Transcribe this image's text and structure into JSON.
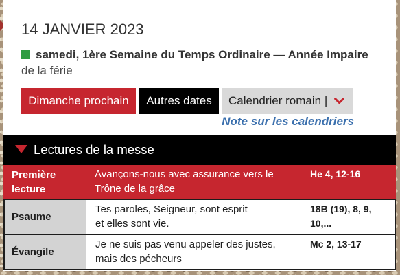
{
  "day": {
    "date": "14 JANVIER 2023",
    "title": "samedi, 1ère Semaine du Temps Ordinaire — Année Impaire",
    "celebration": "de la férie",
    "liturgical_color": "#2e9c42"
  },
  "actions": {
    "next_sunday": "Dimanche prochain",
    "other_dates": "Autres dates",
    "calendar": "Calendrier romain |",
    "calendar_icon": "chevron-down-icon",
    "calendar_note": "Note sur les calendriers"
  },
  "readings": {
    "heading": "Lectures de la messe",
    "heading_icon": "triangle-down-icon",
    "items": [
      {
        "label": "Première lecture",
        "text_lines": [
          "Avançons-nous avec assurance vers le",
          "Trône de la grâce"
        ],
        "reference": "He 4, 12-16",
        "selected": true
      },
      {
        "label": "Psaume",
        "text_lines": [
          "Tes paroles, Seigneur, sont esprit",
          "et elles sont vie."
        ],
        "reference": "18B (19), 8, 9, 10,...",
        "selected": false
      },
      {
        "label": "Évangile",
        "text_lines": [
          "Je ne suis pas venu appeler des justes,",
          "mais des pécheurs"
        ],
        "reference": "Mc 2, 13-17",
        "selected": false
      }
    ]
  },
  "colors": {
    "accent_red": "#c6262f",
    "link_blue": "#3a6fad",
    "label_gray": "#d3d3d3",
    "bar_black": "#000000",
    "button_gray": "#d9d9d9"
  }
}
